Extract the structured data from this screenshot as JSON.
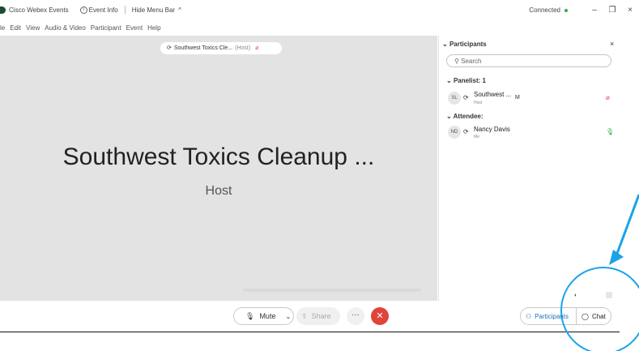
{
  "titlebar": {
    "app_name": "Cisco Webex Events",
    "event_info": "Event Info",
    "hide_menu": "Hide Menu Bar",
    "connection_status": "Connected",
    "colors": {
      "connected": "#3aa845"
    }
  },
  "menu": {
    "items": [
      "le",
      "Edit",
      "View",
      "Audio & Video",
      "Participant",
      "Event",
      "Help"
    ]
  },
  "stage": {
    "pill_name": "Southwest Toxics Cle...",
    "pill_role": "(Host)",
    "speaker_name": "Southwest Toxics Cleanup ...",
    "speaker_role": "Host"
  },
  "participants_panel": {
    "title": "Participants",
    "search_placeholder": "Search",
    "panelist_header": "Panelist: 1",
    "attendee_header": "Attendee:",
    "panelists": [
      {
        "initials": "SL",
        "name": "Southwest ...",
        "role": "Host",
        "extra": "M",
        "mic": "muted"
      }
    ],
    "attendees": [
      {
        "initials": "ND",
        "name": "Nancy Davis",
        "role": "Me",
        "mic": "on"
      }
    ]
  },
  "controls": {
    "mute_label": "Mute",
    "share_label": "Share",
    "more_label": "···",
    "end_label": "✕",
    "participants_label": "Participants",
    "chat_label": "Chat",
    "colors": {
      "end": "#e0453a",
      "participants": "#1f6fb5"
    }
  },
  "annotation": {
    "color": "#1aa3e8"
  }
}
